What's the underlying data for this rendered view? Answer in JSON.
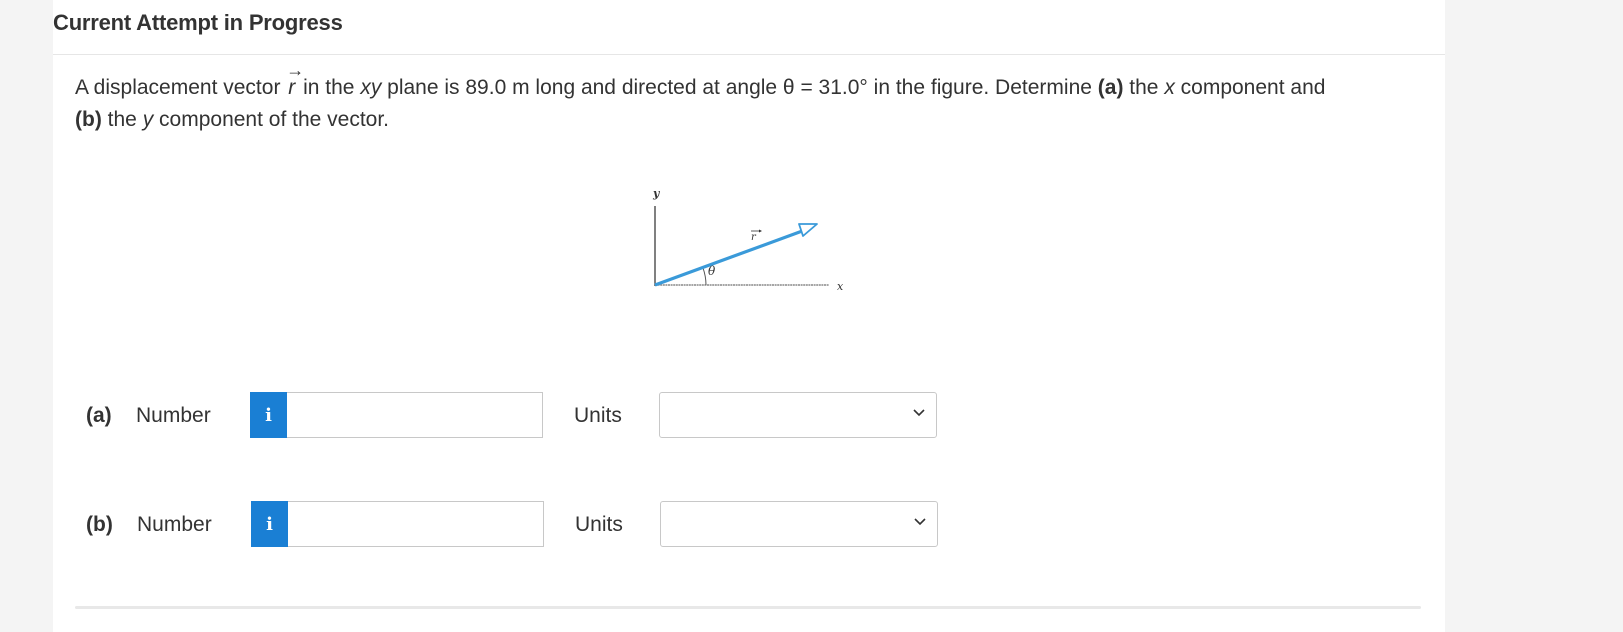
{
  "header": {
    "title": "Current Attempt in Progress"
  },
  "question": {
    "text_1": "A displacement vector ",
    "vector_symbol": "r",
    "vector_arrow": "→",
    "text_2": " in the ",
    "plane": "xy",
    "text_3": " plane is 89.0 m long and directed at angle θ = 31.0° in the figure. Determine ",
    "part_a_marker": "(a)",
    "text_4": " the ",
    "x_var": "x",
    "text_5": " component and ",
    "part_b_marker": "(b)",
    "text_6": " the ",
    "y_var": "y",
    "text_7": " component of the vector."
  },
  "figure": {
    "y_axis_label": "y",
    "x_axis_label": "x",
    "vector_label": "r",
    "angle_label": "θ",
    "vector_color": "#3a9ad9"
  },
  "answers": [
    {
      "part": "(a)",
      "number_label": "Number",
      "info_label": "i",
      "number_value": "",
      "units_label": "Units",
      "units_value": ""
    },
    {
      "part": "(b)",
      "number_label": "Number",
      "info_label": "i",
      "number_value": "",
      "units_label": "Units",
      "units_value": ""
    }
  ],
  "colors": {
    "info_button": "#1a7fd4",
    "background": "#f4f4f4",
    "card": "#ffffff"
  }
}
